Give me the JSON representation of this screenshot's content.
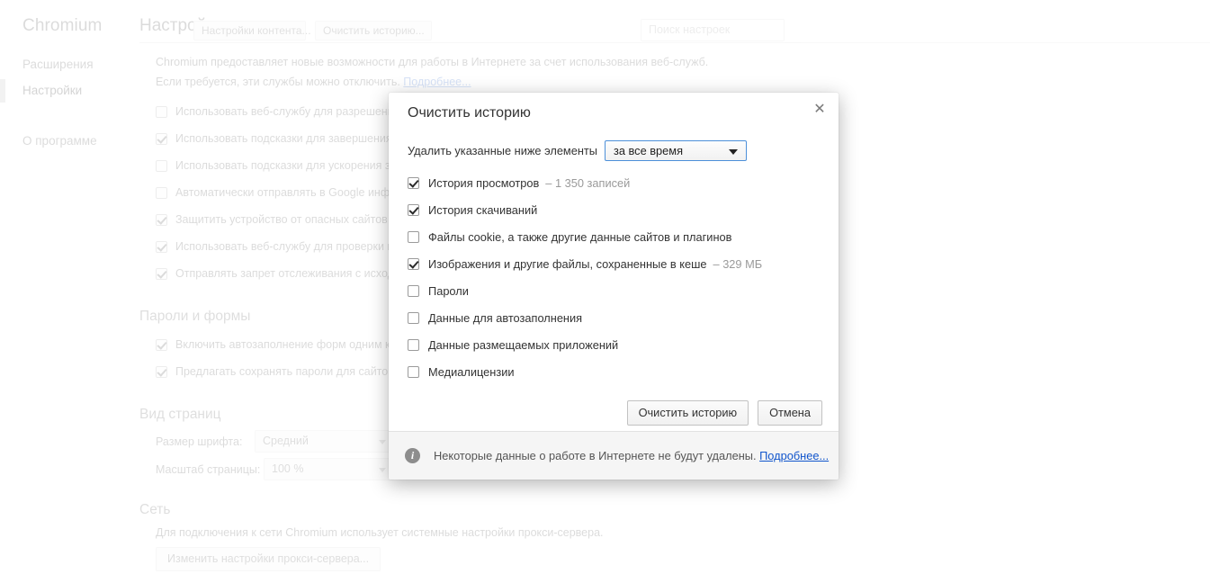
{
  "sidebar": {
    "brand": "Chromium",
    "items": [
      {
        "label": "Расширения",
        "selected": false
      },
      {
        "label": "Настройки",
        "selected": true
      },
      {
        "label": "О программе",
        "selected": false
      }
    ]
  },
  "header": {
    "title": "Настройки",
    "ghost_buttons": [
      "Настройки контента...",
      "Очистить историю..."
    ]
  },
  "search": {
    "value": "",
    "placeholder": "Поиск настроек"
  },
  "page": {
    "intro_line1": "Chromium предоставляет новые возможности для работы в Интернете за счет использования веб-служб.",
    "intro_line2": "Если требуется, эти службы можно отключить.",
    "intro_link": "Подробнее...",
    "privacy_checkboxes": [
      {
        "label": "Использовать веб-службу для разрешения проблем, связанных с навигацией",
        "checked": false
      },
      {
        "label": "Использовать подсказки для завершения поисковых запросов и URL, вводимых в адресной строке",
        "checked": true
      },
      {
        "label": "Использовать подсказки для ускорения загрузки страниц",
        "checked": false
      },
      {
        "label": "Автоматически отправлять в Google информацию о возможных нарушениях безопасности",
        "checked": false
      },
      {
        "label": "Защитить устройство от опасных сайтов",
        "checked": true
      },
      {
        "label": "Использовать веб-службу для проверки правописания",
        "checked": true
      },
      {
        "label": "Отправлять запрет отслеживания с исходящим трафиком",
        "checked": true
      }
    ],
    "passwords_section": {
      "title": "Пароли и формы",
      "checkboxes": [
        {
          "label": "Включить автозаполнение форм одним кликом",
          "checked": true
        },
        {
          "label": "Предлагать сохранять пароли для сайтов Настроить",
          "checked": true
        }
      ]
    },
    "appearance_section": {
      "title": "Вид страниц",
      "font_size_label": "Размер шрифта:",
      "font_size_value": "Средний",
      "page_zoom_label": "Масштаб страницы:",
      "page_zoom_value": "100 %"
    },
    "network_section": {
      "title": "Сеть",
      "description": "Для подключения к сети Chromium использует системные настройки прокси-сервера.",
      "proxy_button": "Изменить настройки прокси-сервера..."
    }
  },
  "dialog": {
    "title": "Очистить историю",
    "close_label": "✕",
    "range_label": "Удалить указанные ниже элементы",
    "range_value": "за все время",
    "items": [
      {
        "label": "История просмотров",
        "detail": "–  1 350 записей",
        "checked": true
      },
      {
        "label": "История скачиваний",
        "detail": "",
        "checked": true
      },
      {
        "label": "Файлы cookie, а также другие данные сайтов и плагинов",
        "detail": "",
        "checked": false
      },
      {
        "label": "Изображения и другие файлы, сохраненные в кеше",
        "detail": "–  329 МБ",
        "checked": true
      },
      {
        "label": "Пароли",
        "detail": "",
        "checked": false
      },
      {
        "label": "Данные для автозаполнения",
        "detail": "",
        "checked": false
      },
      {
        "label": "Данные размещаемых приложений",
        "detail": "",
        "checked": false
      },
      {
        "label": "Медиалицензии",
        "detail": "",
        "checked": false
      }
    ],
    "confirm_button": "Очистить историю",
    "cancel_button": "Отмена",
    "footer_text": "Некоторые данные о работе в Интернете не будут удалены.",
    "footer_link": "Подробнее...",
    "info_icon_glyph": "i"
  },
  "colors": {
    "focus_blue": "#4d90d9",
    "link_blue": "#1155cc",
    "footer_bg": "#f5f5f5"
  }
}
